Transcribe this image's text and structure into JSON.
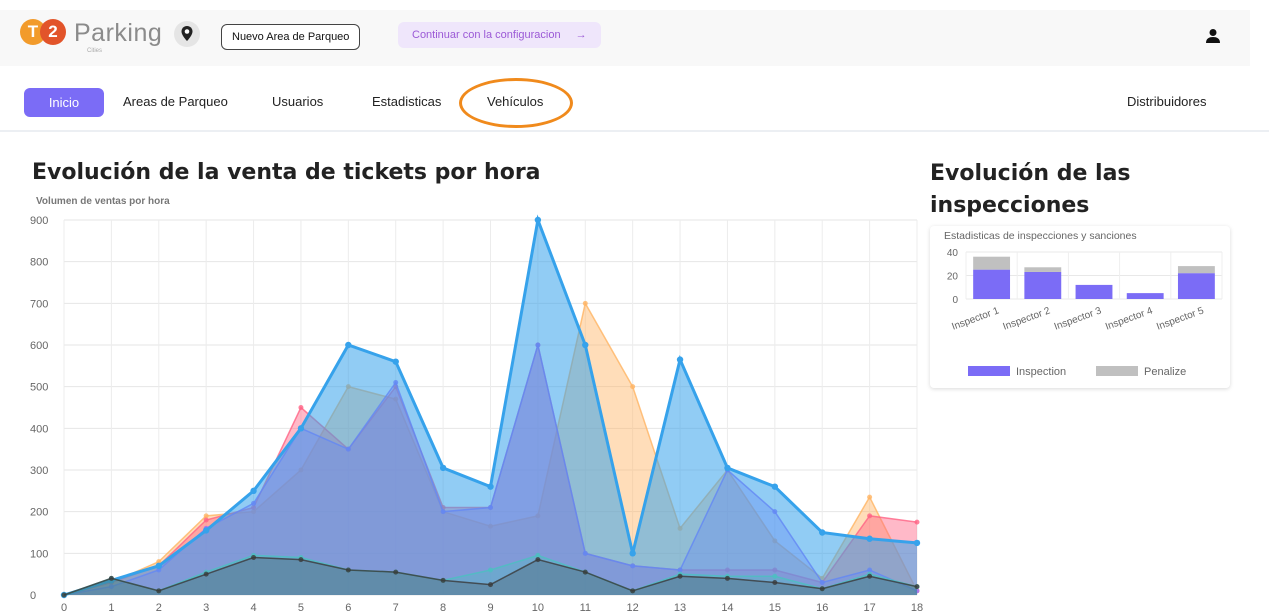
{
  "header": {
    "logo_t": "T",
    "logo_2": "2",
    "brand": "Parking",
    "brand_sub": "Cities",
    "new_area_label": "Nuevo Area de Parqueo",
    "continue_label": "Continuar con la configuracion",
    "continue_arrow": "→"
  },
  "nav": {
    "active": "Inicio",
    "items": [
      "Areas de Parqueo",
      "Usuarios",
      "Estadisticas",
      "Vehículos"
    ],
    "right": "Distribuidores"
  },
  "main_chart": {
    "title": "Evolución de la venta de tickets por hora",
    "subtitle": "Volumen de ventas por hora"
  },
  "side": {
    "title": "Evolución de las inspecciones",
    "subtitle": "Estadisticas de inspecciones y sanciones"
  },
  "colors": {
    "accent": "#7b6cf6",
    "highlight": "#f08a1c",
    "blue": "#36a2eb",
    "orange": "#ffb463",
    "red": "#ff6384",
    "purple": "#9966ff",
    "gray": "#c9cbcf"
  },
  "chart_data": [
    {
      "type": "area",
      "ylim": [
        0,
        900
      ],
      "yticks": [
        0,
        100,
        200,
        300,
        400,
        500,
        600,
        700,
        800,
        900
      ],
      "x": [
        0,
        1,
        2,
        3,
        4,
        5,
        6,
        7,
        8,
        9,
        10,
        11,
        12,
        13,
        14,
        15,
        16,
        17,
        18
      ],
      "series": [
        {
          "color": "#ffb463",
          "values": [
            0,
            30,
            80,
            190,
            200,
            300,
            500,
            470,
            200,
            165,
            190,
            700,
            500,
            160,
            300,
            130,
            40,
            235,
            10
          ]
        },
        {
          "color": "#ff6384",
          "values": [
            0,
            30,
            70,
            180,
            210,
            450,
            350,
            500,
            210,
            210,
            600,
            100,
            70,
            60,
            60,
            60,
            30,
            190,
            175
          ]
        },
        {
          "color": "#9966ff",
          "values": [
            0,
            20,
            60,
            160,
            220,
            400,
            350,
            510,
            200,
            210,
            600,
            100,
            70,
            60,
            300,
            200,
            30,
            60,
            10
          ]
        },
        {
          "color": "#36a2eb",
          "values": [
            0,
            35,
            70,
            155,
            250,
            400,
            600,
            560,
            305,
            260,
            900,
            600,
            100,
            565,
            305,
            260,
            150,
            135,
            125
          ]
        },
        {
          "color": "#4bc0c0",
          "values": [
            0,
            40,
            10,
            55,
            95,
            90,
            60,
            55,
            35,
            60,
            95,
            55,
            10,
            50,
            45,
            45,
            15,
            50,
            20
          ]
        },
        {
          "color": "#3a3a3a",
          "values": [
            0,
            40,
            10,
            50,
            90,
            85,
            60,
            55,
            35,
            25,
            85,
            55,
            10,
            45,
            40,
            30,
            15,
            45,
            20
          ]
        }
      ]
    },
    {
      "type": "bar",
      "title": "Estadisticas de inspecciones y sanciones",
      "categories": [
        "Inspector 1",
        "Inspector 2",
        "Inspector 3",
        "Inspector 4",
        "Inspector 5"
      ],
      "ylim": [
        0,
        40
      ],
      "yticks": [
        0,
        20,
        40
      ],
      "series": [
        {
          "name": "Inspection",
          "color": "#7b6cf6",
          "values": [
            25,
            23,
            12,
            5,
            22
          ]
        },
        {
          "name": "Penalize",
          "color": "#c0c0c0",
          "values": [
            11,
            4,
            0,
            0,
            6
          ]
        }
      ]
    }
  ]
}
